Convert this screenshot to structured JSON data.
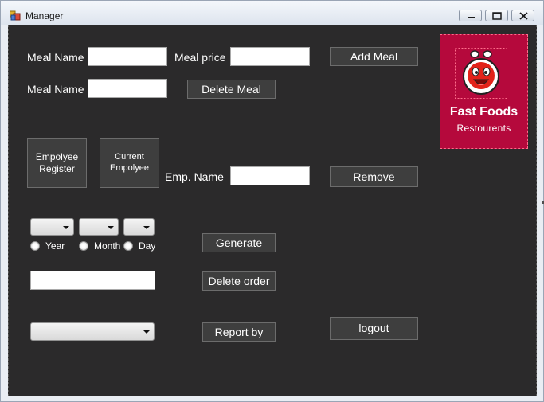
{
  "window": {
    "title": "Manager"
  },
  "meal": {
    "name_label_1": "Meal Name",
    "price_label": "Meal price",
    "add_button": "Add Meal",
    "name_label_2": "Meal Name",
    "delete_button": "Delete Meal"
  },
  "employee": {
    "register_button": "Empolyee Register",
    "current_button": "Current Empolyee",
    "name_label": "Emp. Name",
    "remove_button": "Remove"
  },
  "report": {
    "year_label": "Year",
    "month_label": "Month",
    "day_label": "Day",
    "generate_button": "Generate",
    "delete_order_button": "Delete order",
    "report_by_button": "Report by",
    "logout_button": "logout"
  },
  "logo": {
    "title": "Fast Foods",
    "subtitle": "Restourents",
    "mascot_icon": "bee-mascot-icon",
    "background": "#b5093c"
  },
  "colors": {
    "client_background": "#2b2a2b",
    "button_background": "#3e3e3e"
  }
}
